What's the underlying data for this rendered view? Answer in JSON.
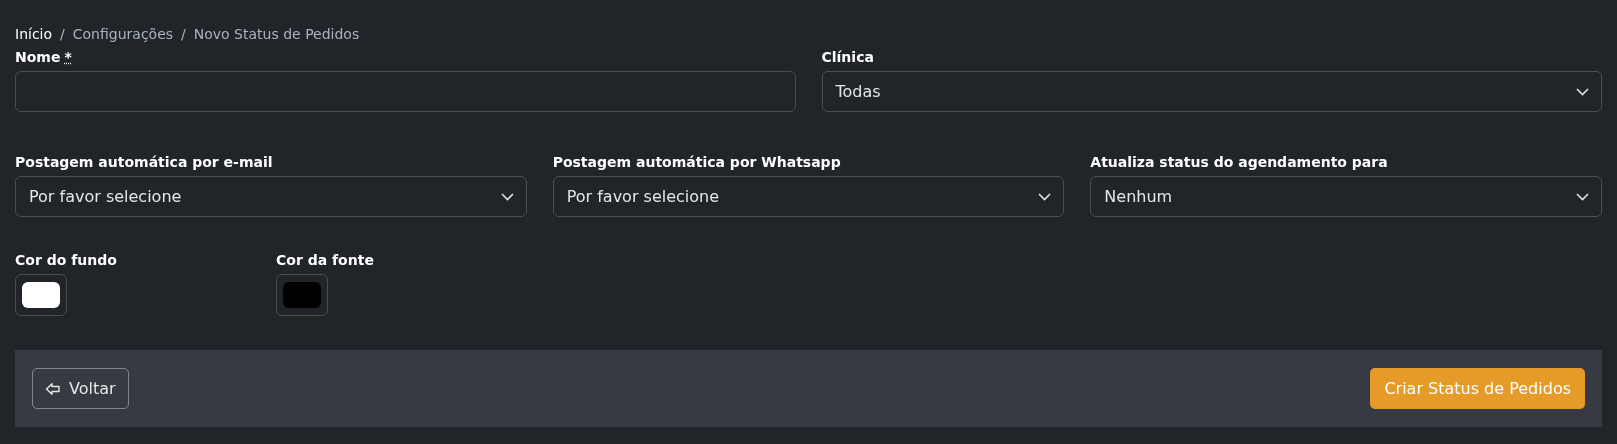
{
  "breadcrumb": [
    "Início",
    "Configurações",
    "Novo Status de Pedidos"
  ],
  "breadcrumb_separator": "/",
  "row1": [
    {
      "kind": "text",
      "label": "Nome",
      "required_mark": "*"
    },
    {
      "kind": "select",
      "label": "Clínica",
      "value": "Todas"
    }
  ],
  "row2": [
    {
      "kind": "select",
      "label": "Postagem automática por e-mail",
      "value": "Por favor selecione"
    },
    {
      "kind": "select",
      "label": "Postagem automática por Whatsapp",
      "value": "Por favor selecione"
    },
    {
      "kind": "select",
      "label": "Atualiza status do agendamento para",
      "value": "Nenhum"
    }
  ],
  "colors": [
    {
      "label": "Cor do fundo",
      "color": "#ffffff"
    },
    {
      "label": "Cor da fonte",
      "color": "#000000"
    }
  ],
  "footer": {
    "back_button": "Voltar",
    "submit_button": "Criar Status de Pedidos"
  }
}
